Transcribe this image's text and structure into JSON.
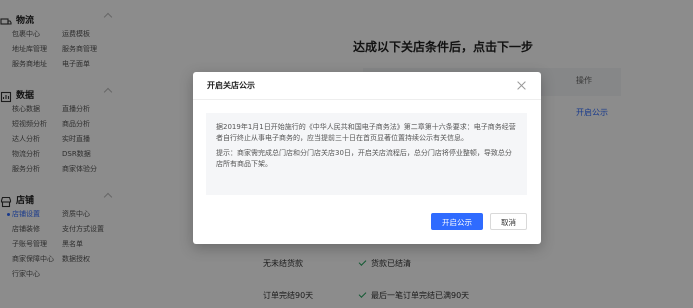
{
  "sidebar": {
    "sections": [
      {
        "title": "物流",
        "icon": "logistics-icon",
        "items": [
          "包裹中心",
          "运费模板",
          "地址库管理",
          "服务商管理",
          "服务商地址",
          "电子面单"
        ]
      },
      {
        "title": "数据",
        "icon": "data-icon",
        "items": [
          "核心数据",
          "直播分析",
          "短视频分析",
          "商品分析",
          "达人分析",
          "实时直播",
          "物流分析",
          "DSR数据",
          "服务分析",
          "商家体验分"
        ]
      },
      {
        "title": "店铺",
        "icon": "store-icon",
        "items": [
          "店铺设置",
          "资质中心",
          "店铺装修",
          "支付方式设置",
          "子账号管理",
          "黑名单",
          "商家保障中心",
          "数据授权",
          "行家中心"
        ],
        "active_index": 0
      }
    ]
  },
  "main": {
    "title": "达成以下关店条件后，点击下一步",
    "op_header": "操作",
    "op_link": "开启公示",
    "rows": [
      {
        "condition": "无未结货款",
        "status": "货款已结清"
      },
      {
        "condition": "订单完结90天",
        "status": "最后一笔订单完结已满90天"
      }
    ]
  },
  "modal": {
    "title": "开启关店公示",
    "body_p1": "据2019年1月1日开始施行的《中华人民共和国电子商务法》第二章第十六条要求：电子商务经营者自行终止从事电子商务的，应当提前三十日在首页显著位置持续公示有关信息。",
    "body_p2": "提示：商家需完成总门店和分门店关店30日，开启关店流程后，总分门店将停业整顿，导致总分店所有商品下架。",
    "confirm_label": "开启公示",
    "cancel_label": "取消"
  },
  "colors": {
    "accent": "#2f6bff",
    "success": "#22a45d"
  }
}
